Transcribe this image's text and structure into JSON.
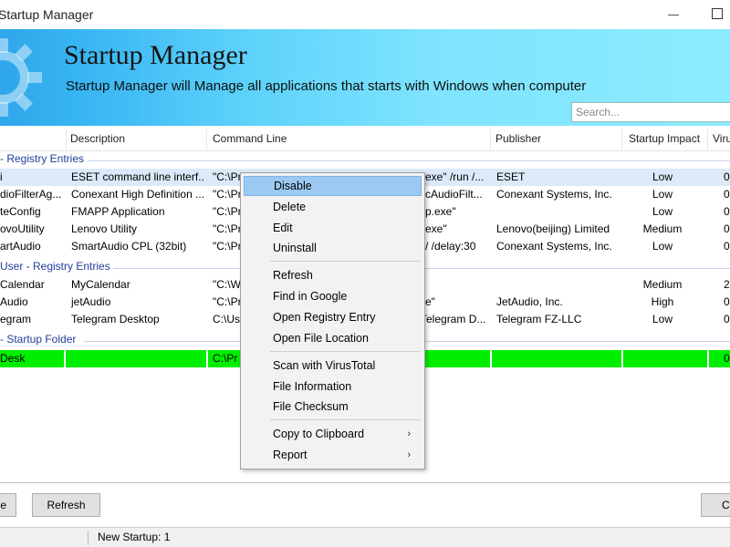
{
  "window": {
    "title": "Startup Manager"
  },
  "banner": {
    "title": "Startup Manager",
    "description": "Startup Manager will Manage all applications that starts with Windows when computer",
    "search_placeholder": "Search..."
  },
  "columns": [
    "Description",
    "Command Line",
    "Publisher",
    "Startup Impact",
    "Viru"
  ],
  "groups": [
    {
      "label": "- Registry Entries",
      "rows": [
        {
          "name": "i",
          "description": "ESET command line interf...",
          "cmd_left": "\"C:\\Pr",
          "cmd_right": "exe\" /run /...",
          "publisher": "ESET",
          "impact": "Low",
          "viru": "0"
        },
        {
          "name": "dioFilterAg...",
          "description": "Conexant High Definition ...",
          "cmd_left": "\"C:\\Pr",
          "cmd_right": "cAudioFilt...",
          "publisher": "Conexant Systems, Inc.",
          "impact": "Low",
          "viru": "0"
        },
        {
          "name": "teConfig",
          "description": "FMAPP Application",
          "cmd_left": "\"C:\\Pr",
          "cmd_right": "p.exe\"",
          "publisher": "",
          "impact": "Low",
          "viru": "0"
        },
        {
          "name": "ovoUtility",
          "description": "Lenovo Utility",
          "cmd_left": "\"C:\\Pr",
          "cmd_right": "exe\"",
          "publisher": "Lenovo(beijing) Limited",
          "impact": "Medium",
          "viru": "0"
        },
        {
          "name": "artAudio",
          "description": "SmartAudio CPL (32bit)",
          "cmd_left": "\"C:\\Pr",
          "cmd_right": "/ /delay:30",
          "publisher": "Conexant Systems, Inc.",
          "impact": "Low",
          "viru": "0"
        }
      ]
    },
    {
      "label": "User - Registry Entries",
      "rows": [
        {
          "name": "Calendar",
          "description": "MyCalendar",
          "cmd_left": "\"C:\\W",
          "cmd_right": "",
          "publisher": "",
          "impact": "Medium",
          "viru": "2"
        },
        {
          "name": "Audio",
          "description": "jetAudio",
          "cmd_left": "\"C:\\Pr",
          "cmd_right": "e\"",
          "publisher": "JetAudio, Inc.",
          "impact": "High",
          "viru": "0"
        },
        {
          "name": "egram",
          "description": "Telegram Desktop",
          "cmd_left": "C:\\Us",
          "cmd_right": "Telegram D...",
          "publisher": "Telegram FZ-LLC",
          "impact": "Low",
          "viru": "0"
        }
      ]
    },
    {
      "label": "- Startup Folder",
      "rows": [
        {
          "name": "Desk",
          "description": "",
          "cmd_left": "C:\\Pr",
          "cmd_right": "",
          "publisher": "",
          "impact": "",
          "viru": "0"
        }
      ]
    }
  ],
  "context_menu": {
    "items": [
      "Disable",
      "Delete",
      "Edit",
      "Uninstall",
      "Refresh",
      "Find in Google",
      "Open Registry Entry",
      "Open File Location",
      "Scan with VirusTotal",
      "File Information",
      "File Checksum",
      "Copy to Clipboard",
      "Report"
    ]
  },
  "bottom": {
    "left_button": "e",
    "refresh_button": "Refresh",
    "right_button": "C"
  },
  "status": {
    "left": "",
    "new_startup": "New Startup: 1"
  }
}
